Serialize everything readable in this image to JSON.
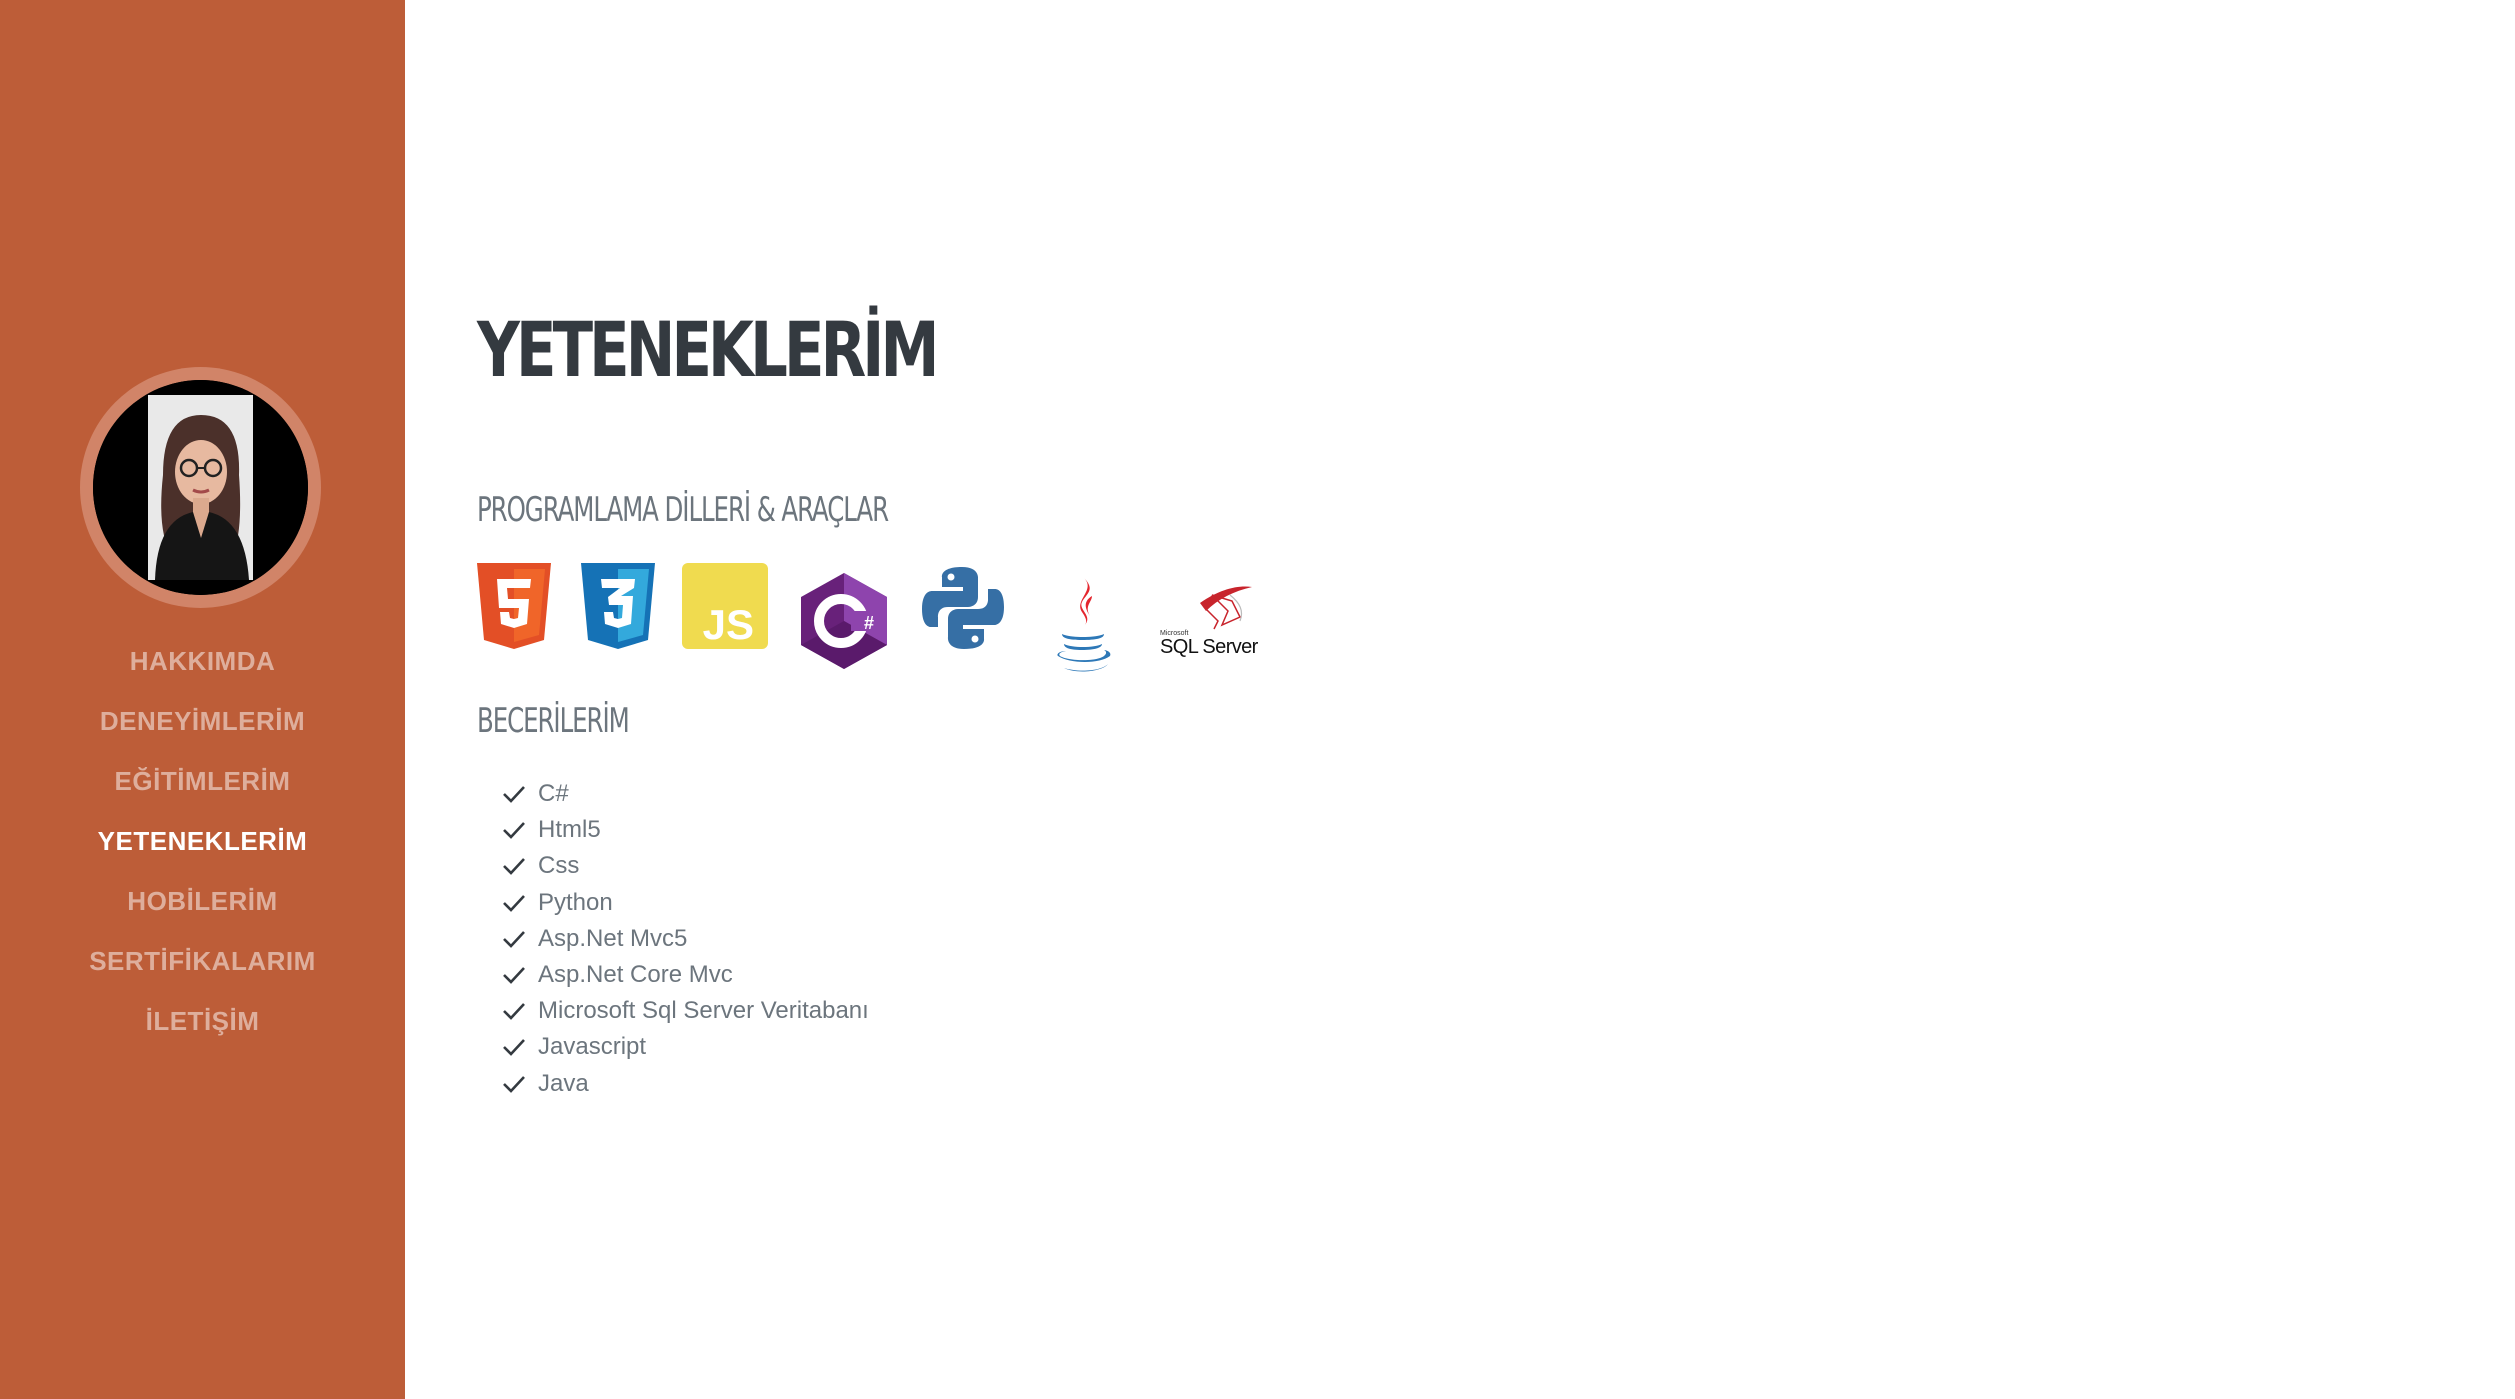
{
  "colors": {
    "sidebar_bg": "#bd5d38",
    "nav_inactive": "rgba(255,255,255,0.5)",
    "nav_active": "#ffffff",
    "heading": "#343a40",
    "muted_text": "#6c757d"
  },
  "sidebar": {
    "avatar_alt": "profile photo",
    "nav": [
      {
        "label": "HAKKIMDA",
        "active": false
      },
      {
        "label": "DENEYİMLERİM",
        "active": false
      },
      {
        "label": "EĞİTİMLERİM",
        "active": false
      },
      {
        "label": "YETENEKLERİM",
        "active": true
      },
      {
        "label": "HOBİLERİM",
        "active": false
      },
      {
        "label": "SERTİFİKALARIM",
        "active": false
      },
      {
        "label": "İLETİŞİM",
        "active": false
      }
    ]
  },
  "main": {
    "title": "YETENEKLERİM",
    "tools_heading": "PROGRAMLAMA DİLLERİ & ARAÇLAR",
    "tools": [
      {
        "icon": "html5-icon"
      },
      {
        "icon": "css3-icon"
      },
      {
        "icon": "javascript-icon",
        "text": "JS"
      },
      {
        "icon": "csharp-icon",
        "text": "C#"
      },
      {
        "icon": "python-icon"
      },
      {
        "icon": "java-icon"
      },
      {
        "icon": "sql-server-icon",
        "text": "SQL Server",
        "small_text": "Microsoft"
      }
    ],
    "skills_heading": "BECERİLERİM",
    "skills": [
      "C#",
      "Html5",
      "Css",
      "Python",
      "Asp.Net Mvc5",
      "Asp.Net Core Mvc",
      "Microsoft Sql Server Veritabanı",
      "Javascript",
      "Java"
    ]
  }
}
